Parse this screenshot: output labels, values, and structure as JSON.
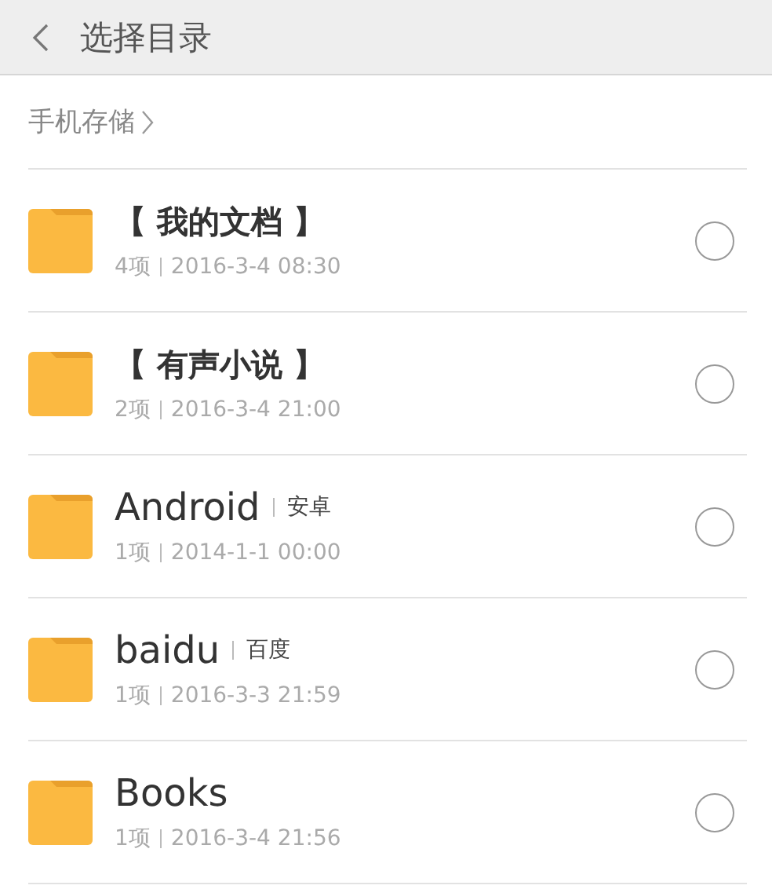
{
  "header": {
    "title": "选择目录"
  },
  "breadcrumb": {
    "label": "手机存储"
  },
  "folders": [
    {
      "name": "【 我的文档 】",
      "count": "4项",
      "date": "2016-3-4 08:30",
      "selected": false
    },
    {
      "name": "【 有声小说 】",
      "count": "2项",
      "date": "2016-3-4 21:00",
      "selected": false
    },
    {
      "name": "Android",
      "tag": "安卓",
      "count": "1项",
      "date": "2014-1-1 00:00",
      "selected": false
    },
    {
      "name": "baidu",
      "tag": "百度",
      "count": "1项",
      "date": "2016-3-3 21:59",
      "selected": false
    },
    {
      "name": "Books",
      "count": "1项",
      "date": "2016-3-4 21:56",
      "selected": false
    }
  ]
}
